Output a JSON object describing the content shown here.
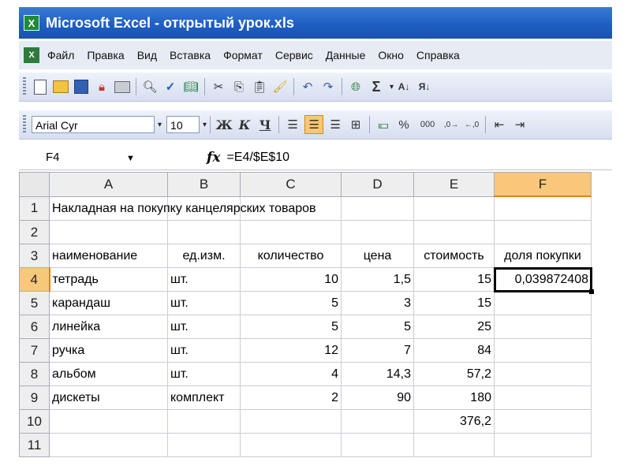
{
  "window": {
    "title": "Microsoft Excel - открытый урок.xls",
    "app_icon": "X"
  },
  "menu": {
    "items": [
      "Файл",
      "Правка",
      "Вид",
      "Вставка",
      "Формат",
      "Сервис",
      "Данные",
      "Окно",
      "Справка"
    ]
  },
  "toolbar_standard": {
    "icons": [
      "new-document-icon",
      "open-folder-icon",
      "save-disk-icon",
      "permission-icon",
      "print-icon",
      "print-preview-icon",
      "spelling-icon",
      "research-icon",
      "cut-icon",
      "copy-icon",
      "paste-icon",
      "format-painter-icon",
      "undo-icon",
      "redo-icon",
      "hyperlink-icon",
      "autosum-icon",
      "sort-ascending-icon",
      "sort-descending-icon"
    ],
    "autosum_glyph": "Σ"
  },
  "toolbar_formatting": {
    "font_name": "Arial Cyr",
    "font_size": "10",
    "bold": "Ж",
    "italic": "К",
    "underline": "Ч",
    "percent": "%",
    "thousands": "000"
  },
  "formula_bar": {
    "name_box": "F4",
    "fx_label": "fx",
    "formula": "=E4/$E$10"
  },
  "sheet": {
    "columns": [
      "A",
      "B",
      "C",
      "D",
      "E",
      "F"
    ],
    "rows": [
      "1",
      "2",
      "3",
      "4",
      "5",
      "6",
      "7",
      "8",
      "9",
      "10",
      "11"
    ],
    "title": "Накладная на покупку канцелярских товаров",
    "headers": [
      "наименование",
      "ед.изм.",
      "количество",
      "цена",
      "стоимость",
      "доля покупки"
    ],
    "data": [
      [
        "тетрадь",
        "шт.",
        "10",
        "1,5",
        "15",
        "0,039872408"
      ],
      [
        "карандаш",
        "шт.",
        "5",
        "3",
        "15",
        ""
      ],
      [
        "линейка",
        "шт.",
        "5",
        "5",
        "25",
        ""
      ],
      [
        "ручка",
        "шт.",
        "12",
        "7",
        "84",
        ""
      ],
      [
        "альбом",
        "шт.",
        "4",
        "14,3",
        "57,2",
        ""
      ],
      [
        "дискеты",
        "комплект",
        "2",
        "90",
        "180",
        ""
      ]
    ],
    "total": "376,2",
    "active_cell": "F4"
  }
}
